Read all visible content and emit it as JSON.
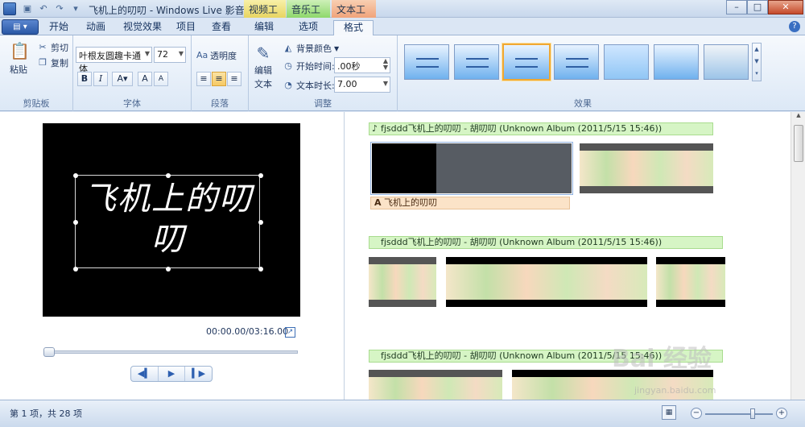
{
  "titlebar": {
    "title": "飞机上的叨叨 - Windows Live 影音制作",
    "context_tabs": [
      "视频工具",
      "音乐工具",
      "文本工具"
    ],
    "qat_icons": [
      "save-icon",
      "undo-icon",
      "redo-icon",
      "customize-icon"
    ]
  },
  "tabs": {
    "items": [
      "开始",
      "动画",
      "视觉效果",
      "项目",
      "查看",
      "编辑",
      "选项",
      "格式"
    ],
    "active": "格式"
  },
  "ribbon": {
    "clipboard": {
      "paste": "粘贴",
      "cut": "剪切",
      "copy": "复制",
      "label": "剪贴板"
    },
    "font": {
      "family": "叶根友圆趣卡通体",
      "size": "72",
      "bold": "B",
      "italic": "I",
      "color": "A",
      "grow": "A",
      "shrink": "A",
      "label": "字体"
    },
    "paragraph": {
      "transparency": "透明度",
      "label": "段落"
    },
    "adjust": {
      "edit_text_1": "编辑",
      "edit_text_2": "文本",
      "bg_color": "背景颜色",
      "start_time_label": "开始时间:",
      "start_time_value": ".00秒",
      "duration_label": "文本时长:",
      "duration_value": "7.00",
      "label": "调整"
    },
    "effects": {
      "label": "效果",
      "selected_index": 2,
      "count": 7
    }
  },
  "preview": {
    "caption": "飞机上的叨叨",
    "time": "00:00.00/03:16.00"
  },
  "timeline": {
    "audio_label": "fjsddd飞机上的叨叨 - 胡叨叨 (Unknown Album (2011/5/15 15:46))",
    "caption_label": "飞机上的叨叨"
  },
  "status": {
    "items": "第 1 项，共 28 项"
  },
  "watermark": {
    "main": "Bai 经验",
    "sub": "jingyan.baidu.com"
  },
  "colors": {
    "ctx_video": "#e8d561",
    "ctx_music": "#8ed86b",
    "ctx_text": "#f0a37a",
    "accent": "#2a58a6",
    "selection": "#f0a832"
  }
}
